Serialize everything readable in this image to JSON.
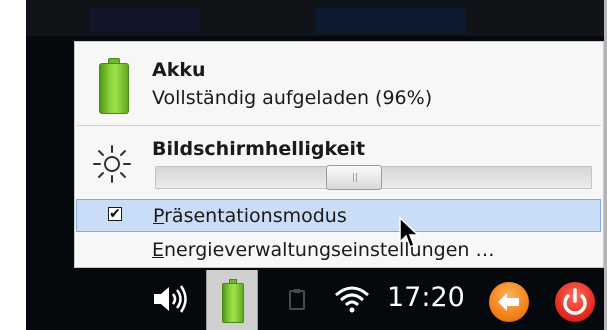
{
  "battery_section": {
    "title": "Akku",
    "status": "Vollständig aufgeladen (96%)",
    "level_percent": 96
  },
  "brightness_section": {
    "title": "Bildschirmhelligkeit",
    "slider_value_percent": 45
  },
  "presentation_mode": {
    "label": "Präsentationsmodus",
    "checked": true,
    "check_glyph": "✔"
  },
  "power_settings": {
    "label": "Energieverwaltungseinstellungen …"
  },
  "taskbar": {
    "clock": "17:20",
    "icons": [
      "volume-icon",
      "battery-icon",
      "clipboard-icon",
      "wifi-icon",
      "back-icon",
      "power-icon"
    ]
  },
  "colors": {
    "battery_green": "#8ad43a",
    "highlight": "#c9ddf6",
    "back_orange": "#f07b12",
    "power_red": "#e0261a"
  }
}
